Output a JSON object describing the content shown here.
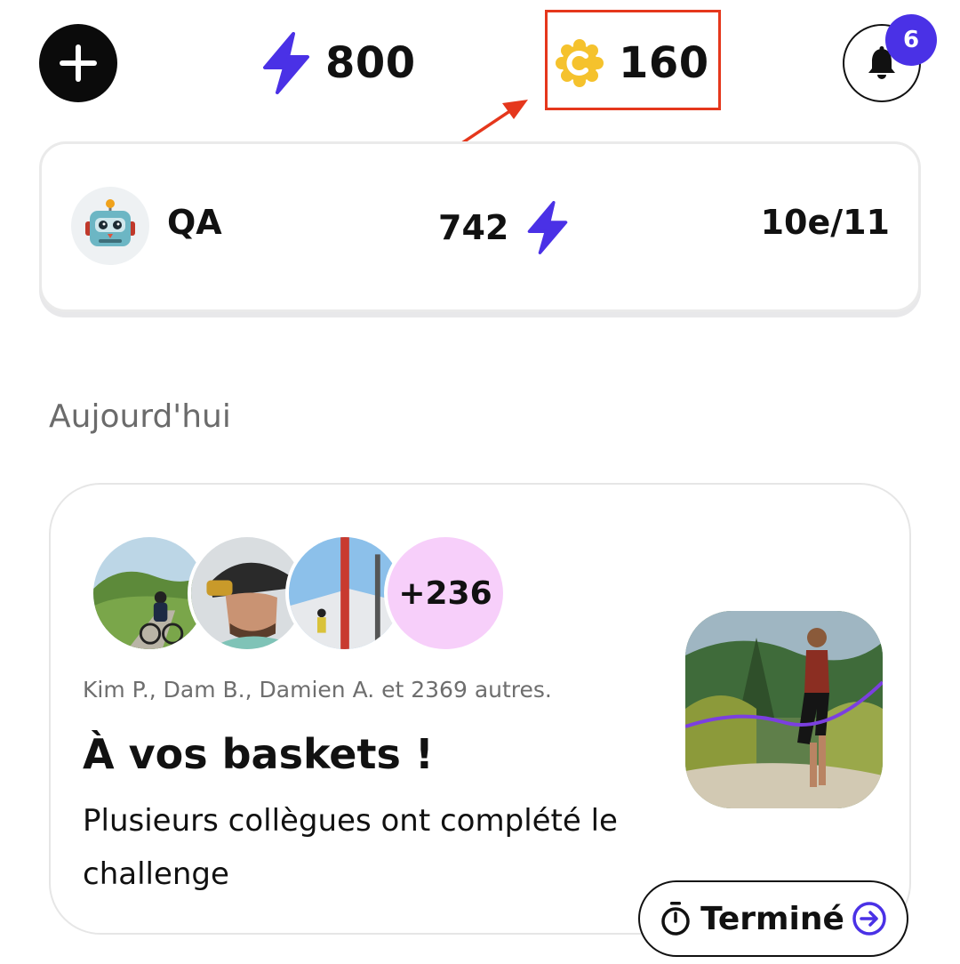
{
  "header": {
    "add_icon": "plus-icon",
    "energy": {
      "icon": "lightning-bolt-icon",
      "value": "800",
      "color": "#4a31e6"
    },
    "coins": {
      "icon": "coin-icon",
      "value": "160",
      "color": "#f5c22d"
    },
    "notifications": {
      "icon": "bell-icon",
      "count": "6",
      "badge_color": "#4a31e6"
    }
  },
  "annotation": {
    "color": "#e5371c"
  },
  "team": {
    "avatar_icon": "robot-icon",
    "name": "QA",
    "points": "742",
    "rank": "10e/11"
  },
  "feed": {
    "section_title": "Aujourd'hui",
    "card": {
      "extra_count": "+236",
      "participants": "Kim P., Dam B., Damien A. et 2369 autres.",
      "title": "À vos baskets !",
      "description": "Plusieurs collègues ont complété le challenge",
      "status_label": "Terminé",
      "status_icon": "timer-icon",
      "action_icon": "arrow-right-circle-icon"
    }
  }
}
